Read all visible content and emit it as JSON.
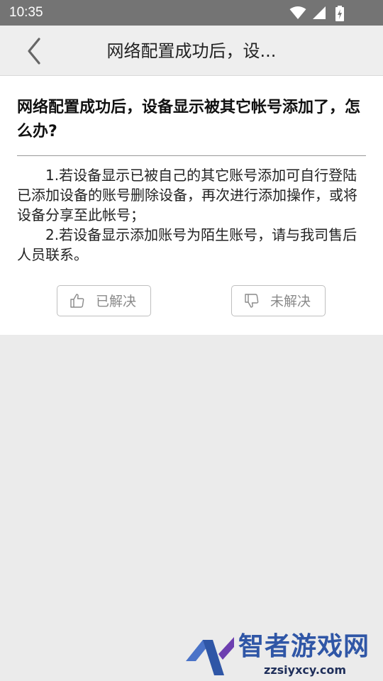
{
  "status_bar": {
    "time": "10:35"
  },
  "app_bar": {
    "title": "网络配置成功后，设..."
  },
  "question": {
    "title": "网络配置成功后，设备显示被其它帐号添加了，怎么办?",
    "answer": [
      "1.若设备显示已被自己的其它账号添加可自行登陆已添加设备的账号删除设备，再次进行添加操作，或将设备分享至此帐号；",
      "2.若设备显示添加账号为陌生账号，请与我司售后人员联系。"
    ]
  },
  "feedback": {
    "solved_label": "已解决",
    "solved_icon": "thumbs-up-icon",
    "unsolved_label": "未解决",
    "unsolved_icon": "thumbs-down-icon"
  },
  "watermark": {
    "name": "智者游戏网",
    "url": "zzsiyxcy.com"
  },
  "colors": {
    "status_bar": "#747474",
    "app_bar": "#eeeeee",
    "page_background": "#ebebeb",
    "card": "#ffffff",
    "button_text": "#8a8a8a",
    "watermark_blue": "#2f56a6"
  }
}
